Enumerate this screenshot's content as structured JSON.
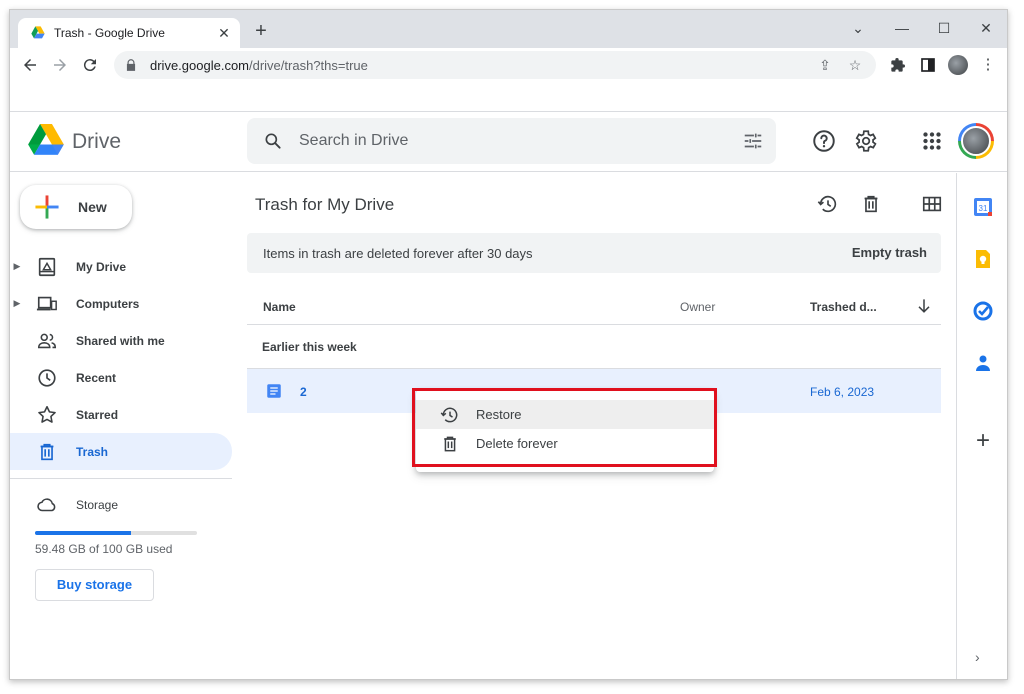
{
  "browser": {
    "tab_title": "Trash - Google Drive",
    "new_tab_label": "+",
    "url_host": "drive.google.com",
    "url_path": "/drive/trash?ths=true"
  },
  "header": {
    "brand": "Drive",
    "search_placeholder": "Search in Drive"
  },
  "sidebar": {
    "new_label": "New",
    "items": [
      {
        "label": "My Drive",
        "icon": "my-drive-icon"
      },
      {
        "label": "Computers",
        "icon": "computers-icon"
      },
      {
        "label": "Shared with me",
        "icon": "people-icon"
      },
      {
        "label": "Recent",
        "icon": "clock-icon"
      },
      {
        "label": "Starred",
        "icon": "star-icon"
      },
      {
        "label": "Trash",
        "icon": "trash-icon"
      },
      {
        "label": "Storage",
        "icon": "cloud-icon"
      }
    ],
    "storage_used_fraction": 0.5948,
    "storage_text": "59.48 GB of 100 GB used",
    "buy_storage": "Buy storage"
  },
  "main": {
    "title": "Trash for My Drive",
    "banner_text": "Items in trash are deleted forever after 30 days",
    "empty_trash": "Empty trash",
    "columns": {
      "name": "Name",
      "owner": "Owner",
      "trashed": "Trashed d..."
    },
    "section_label": "Earlier this week",
    "files": [
      {
        "name": "2",
        "trashed_date": "Feb 6, 2023"
      }
    ]
  },
  "context_menu": {
    "items": [
      {
        "label": "Restore",
        "icon": "restore-icon"
      },
      {
        "label": "Delete forever",
        "icon": "trash-icon"
      }
    ],
    "highlight_color": "#e0101e"
  },
  "colors": {
    "accent": "#1a73e8",
    "selected_bg": "#e8f0fe",
    "selected_text": "#1967d2"
  }
}
